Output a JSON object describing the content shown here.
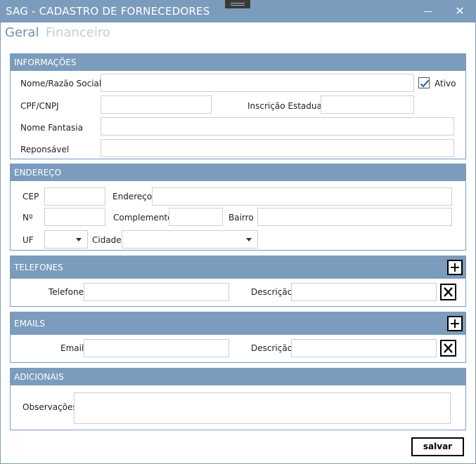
{
  "window": {
    "title": "SAG - CADASTRO DE FORNECEDORES",
    "minimize_label": "",
    "close_label": "✕"
  },
  "tabs": [
    {
      "label": "Geral",
      "active": true
    },
    {
      "label": "Financeiro",
      "active": false
    }
  ],
  "informacoes": {
    "header": "INFORMAÇÕES",
    "nome_label": "Nome/Razão Social",
    "nome_value": "",
    "ativo_label": "Ativo",
    "ativo_checked": true,
    "cpf_label": "CPF/CNPJ",
    "cpf_value": "",
    "inscricao_label": "Inscrição Estadual",
    "inscricao_value": "",
    "fantasia_label": "Nome Fantasia",
    "fantasia_value": "",
    "responsavel_label": "Reponsável",
    "responsavel_value": ""
  },
  "endereco": {
    "header": "ENDEREÇO",
    "cep_label": "CEP",
    "endereco_label": "Endereço",
    "numero_label": "Nº",
    "complemento_label": "Complemento",
    "bairro_label": "Bairro",
    "uf_label": "UF",
    "uf_value": "",
    "cidade_label": "Cidade",
    "cidade_value": ""
  },
  "telefones": {
    "header": "TELEFONES",
    "telefone_label": "Telefone",
    "descricao_label": "Descrição"
  },
  "emails": {
    "header": "EMAILS",
    "email_label": "Email",
    "descricao_label": "Descrição"
  },
  "adicionais": {
    "header": "ADICIONAIS",
    "observacoes_label": "Observações",
    "observacoes_value": ""
  },
  "footer": {
    "salvar_label": "salvar"
  },
  "colors": {
    "accent": "#7b9cbc",
    "tab_active": "#6f93b8",
    "tab_inactive": "#c4cdd6",
    "check": "#2b6cb0"
  },
  "icons": {
    "add": "plus-icon",
    "remove": "close-icon",
    "check": "checkmark-icon",
    "dropdown": "chevron-down-icon"
  }
}
